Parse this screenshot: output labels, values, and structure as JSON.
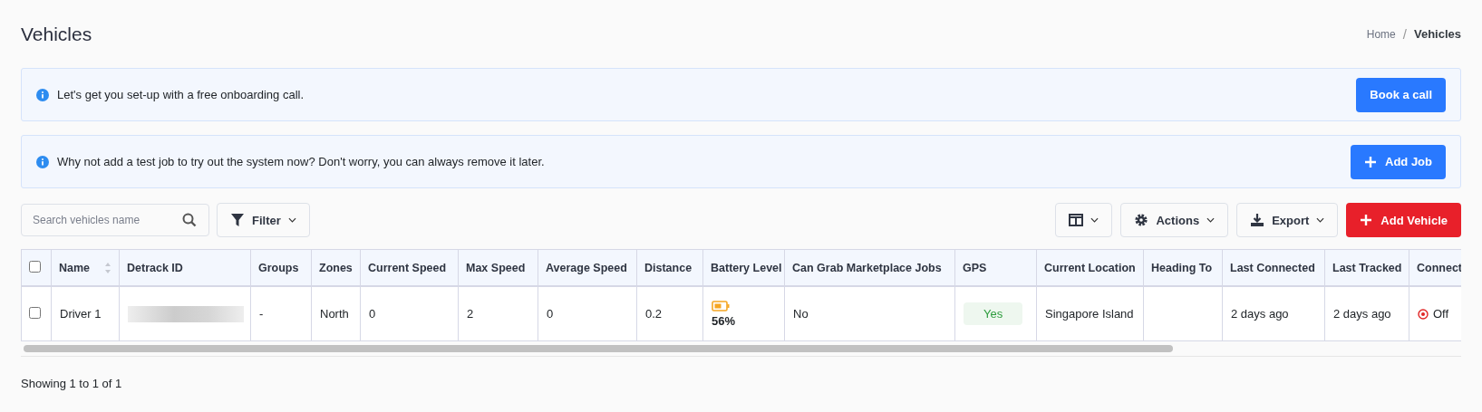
{
  "page": {
    "title": "Vehicles"
  },
  "breadcrumb_separator": "/",
  "breadcrumb": [
    {
      "label": "Home",
      "current": false
    },
    {
      "label": "Vehicles",
      "current": true
    }
  ],
  "banners": [
    {
      "text": "Let's get you set-up with a free onboarding call.",
      "button": {
        "label": "Book a call"
      }
    },
    {
      "text": "Why not add a test job to try out the system now? Don't worry, you can always remove it later.",
      "button": {
        "label": "Add Job"
      }
    }
  ],
  "toolbar": {
    "search": {
      "placeholder": "Search vehicles name"
    },
    "filter": "Filter",
    "actions": "Actions",
    "export": "Export",
    "add": "Add Vehicle"
  },
  "table": {
    "select_all_checked": false,
    "columns": [
      {
        "label": "Name"
      },
      {
        "label": "Detrack ID"
      },
      {
        "label": "Groups"
      },
      {
        "label": "Zones"
      },
      {
        "label": "Current Speed"
      },
      {
        "label": "Max Speed"
      },
      {
        "label": "Average Speed"
      },
      {
        "label": "Distance"
      },
      {
        "label": "Battery Level"
      },
      {
        "label": "Can Grab Marketplace Jobs"
      },
      {
        "label": "GPS"
      },
      {
        "label": "Current Location"
      },
      {
        "label": "Heading To"
      },
      {
        "label": "Last Connected"
      },
      {
        "label": "Last Tracked"
      },
      {
        "label": "Connect"
      }
    ],
    "rows": [
      {
        "checked": false,
        "cells": [
          {
            "kind": "text",
            "text": "Driver 1"
          },
          {
            "kind": "redacted"
          },
          {
            "kind": "text",
            "text": "-"
          },
          {
            "kind": "text",
            "text": "North"
          },
          {
            "kind": "text",
            "text": "0"
          },
          {
            "kind": "text",
            "text": "2"
          },
          {
            "kind": "text",
            "text": "0"
          },
          {
            "kind": "text",
            "text": "0.2"
          },
          {
            "kind": "battery",
            "text": "56%"
          },
          {
            "kind": "text",
            "text": "No"
          },
          {
            "kind": "badge",
            "text": "Yes"
          },
          {
            "kind": "text",
            "text": "Singapore Island"
          },
          {
            "kind": "empty"
          },
          {
            "kind": "text",
            "text": "2 days ago"
          },
          {
            "kind": "text",
            "text": "2 days ago"
          },
          {
            "kind": "status",
            "text": "Off",
            "on": false
          }
        ]
      }
    ]
  },
  "footer": "Showing 1 to 1 of 1"
}
